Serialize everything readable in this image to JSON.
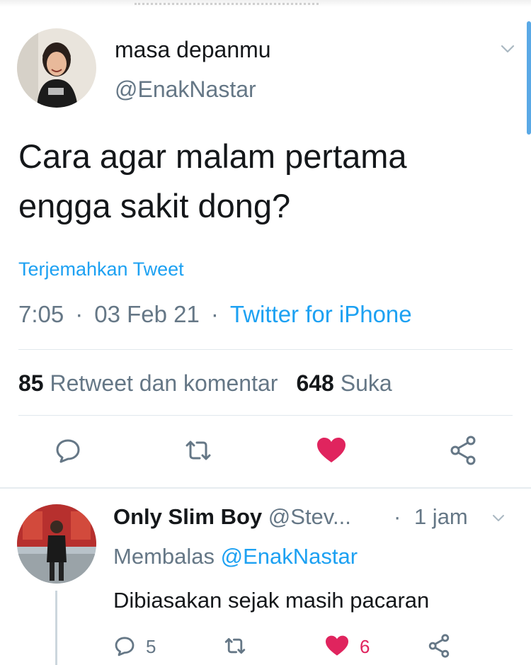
{
  "tweet": {
    "author_name": "masa depanmu",
    "author_handle": "@EnakNastar",
    "text_line1": "Cara agar malam pertama",
    "text_line2": "engga sakit dong?",
    "translate_label": "Terjemahkan Tweet",
    "time": "7:05",
    "date": "03 Feb 21",
    "source": "Twitter for iPhone",
    "separator": "·",
    "retweet_count": "85",
    "retweet_label": "Retweet dan komentar",
    "like_count": "648",
    "like_label": "Suka",
    "liked": true,
    "icons": [
      "reply-icon",
      "retweet-icon",
      "like-icon",
      "share-icon",
      "chevron-down-icon"
    ]
  },
  "reply": {
    "author_name": "Only Slim Boy",
    "author_handle": "@Stev...",
    "separator": "·",
    "time": "1 jam",
    "replying_prefix": "Membalas",
    "replying_to": "@EnakNastar",
    "text": "Dibiasakan sejak masih pacaran",
    "reply_count": "5",
    "like_count": "6",
    "liked": true
  },
  "colors": {
    "accent": "#1da1f2",
    "like": "#e0245e",
    "muted": "#657786",
    "text": "#14171a"
  }
}
